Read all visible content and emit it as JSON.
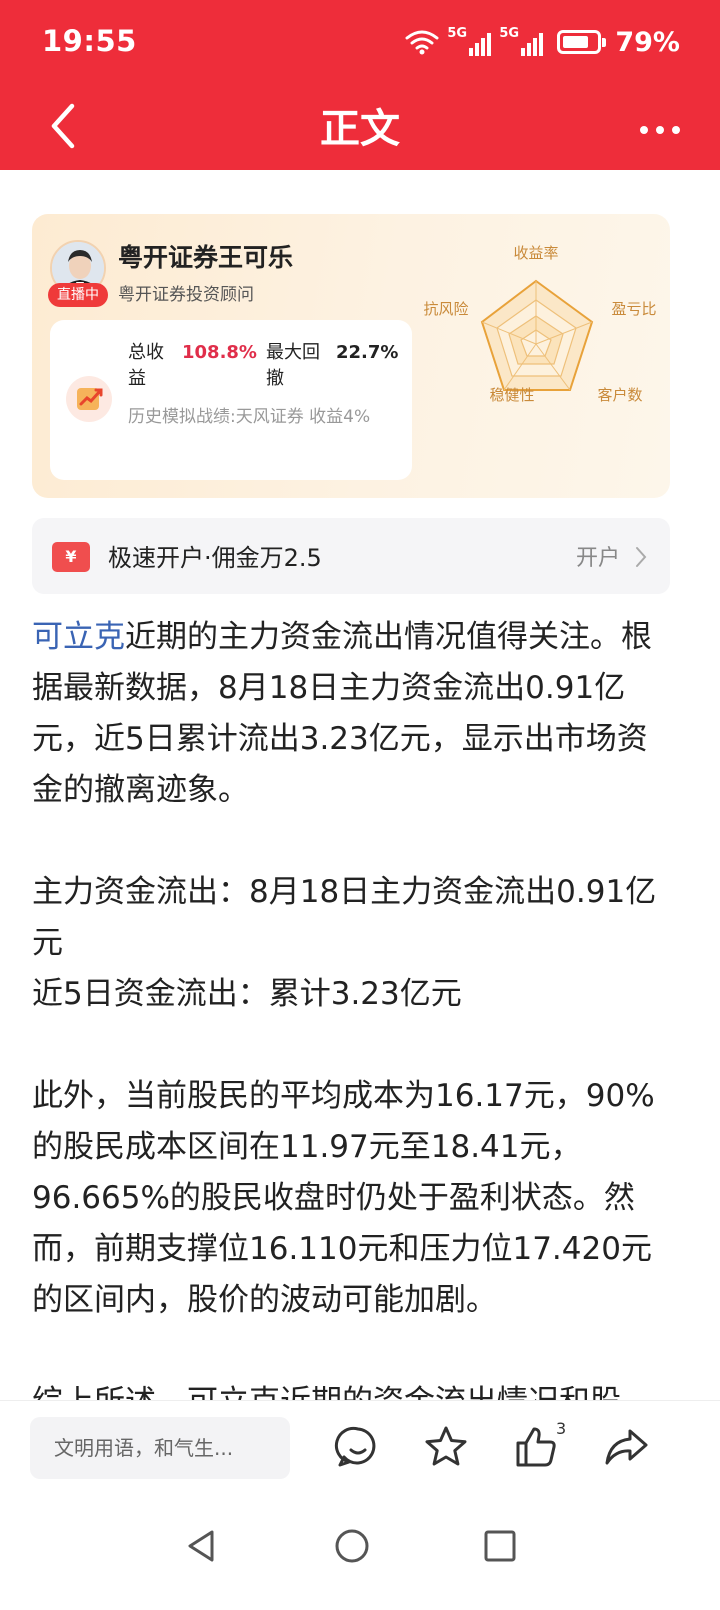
{
  "status_bar": {
    "time": "19:55",
    "network1": "5G",
    "network2": "5G",
    "battery": "79%",
    "battery_level": 0.79
  },
  "nav": {
    "title": "正文",
    "back_icon": "back-arrow-icon",
    "more_icon": "more-dots-icon"
  },
  "advisor_card": {
    "name": "粤开证券王可乐",
    "role": "粤开证券投资顾问",
    "live_badge": "直播中",
    "total_return_label": "总收益",
    "total_return_value": "108.8%",
    "max_drawdown_label": "最大回撤",
    "max_drawdown_value": "22.7%",
    "history": "历史模拟战绩:天风证券 收益4%",
    "radar_labels": [
      "收益率",
      "盈亏比",
      "客户数",
      "稳健性",
      "抗风险"
    ],
    "accent_color": "#e8a23a",
    "value_color": "#e02e4a"
  },
  "promo": {
    "text": "极速开户·佣金万2.5",
    "action": "开户",
    "ticket_symbol": "¥"
  },
  "article": {
    "stock_name": "可立克",
    "p1_rest": "近期的主力资金流出情况值得关注。根据最新数据，8月18日主力资金流出0.91亿元，近5日累计流出3.23亿元，显示出市场资金的撤离迹象。",
    "p2_line1": "主力资金流出：8月18日主力资金流出0.91亿元",
    "p2_line2": "近5日资金流出：累计3.23亿元",
    "p3": "此外，当前股民的平均成本为16.17元，90%的股民成本区间在11.97元至18.41元，96.665%的股民收盘时仍处于盈利状态。然而，前期支撑位16.110元和压力位17.420元的区间内，股价的波动可能加剧。",
    "p4": "综上所述，可立克近期的资金流出情况和股"
  },
  "bottom_bar": {
    "comment_placeholder": "文明用语，和气生...",
    "like_count": "3",
    "icons": [
      "comment-icon",
      "star-icon",
      "thumbs-up-icon",
      "share-icon"
    ]
  },
  "system_nav": {
    "icons": [
      "nav-back-icon",
      "nav-home-icon",
      "nav-recents-icon"
    ]
  }
}
